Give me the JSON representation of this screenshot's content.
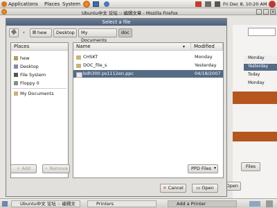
{
  "top_panel": {
    "menus": [
      "Applications",
      "Places",
      "System"
    ],
    "clock": "Fri Dec 8, 10:20 AM"
  },
  "firefox": {
    "title": "Ubuntu中文 论坛 :: 编辑文章 - Mozilla Firefox",
    "right_items": [
      "Monday",
      "Yesterday",
      "Today",
      "Monday"
    ],
    "right_buttons": [
      "Files",
      "Open"
    ]
  },
  "dialog": {
    "title": "Select a file",
    "path_buttons": [
      "hew",
      "Desktop",
      "My Documents",
      "doc"
    ],
    "places_header": "Places",
    "places": [
      "hew",
      "Desktop",
      "File System",
      "Floppy 0",
      "My Documents"
    ],
    "add_label": "Add",
    "remove_label": "Remove",
    "col_name": "Name",
    "col_modified": "Modified",
    "files": [
      {
        "name": "CHSKT",
        "modified": "Monday",
        "type": "folder"
      },
      {
        "name": "DOC_file_s",
        "modified": "Yesterday",
        "type": "folder"
      },
      {
        "name": "bdh300 ps1112en.ppc",
        "modified": "04/18/2007",
        "type": "file",
        "selected": true
      }
    ],
    "filter_value": "PPD Files",
    "cancel_label": "Cancel",
    "open_label": "Open"
  },
  "taskbar": {
    "tasks": [
      "Ubuntu中文 论坛 :: 编辑文",
      "Printers",
      "Add a Printer"
    ]
  }
}
